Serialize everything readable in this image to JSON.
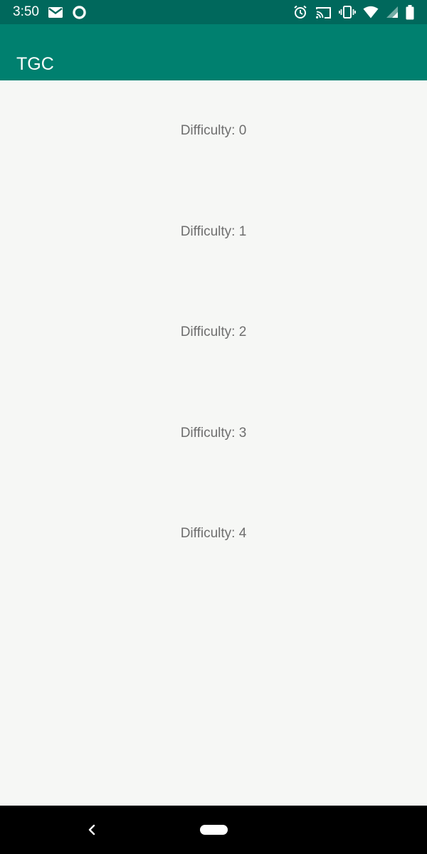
{
  "status_bar": {
    "time": "3:50",
    "icons": [
      "gmail-icon",
      "circle-notification-icon",
      "alarm-icon",
      "cast-icon",
      "vibrate-icon",
      "wifi-icon",
      "cell-signal-icon",
      "battery-icon"
    ]
  },
  "app_bar": {
    "title": "TGC"
  },
  "difficulties": [
    {
      "label": "Difficulty: 0"
    },
    {
      "label": "Difficulty: 1"
    },
    {
      "label": "Difficulty: 2"
    },
    {
      "label": "Difficulty: 3"
    },
    {
      "label": "Difficulty: 4"
    }
  ],
  "colors": {
    "status_bar": "#00685c",
    "app_bar": "#00806f",
    "background": "#f6f7f5",
    "text": "#6e6e6e",
    "nav_bar": "#000000"
  }
}
